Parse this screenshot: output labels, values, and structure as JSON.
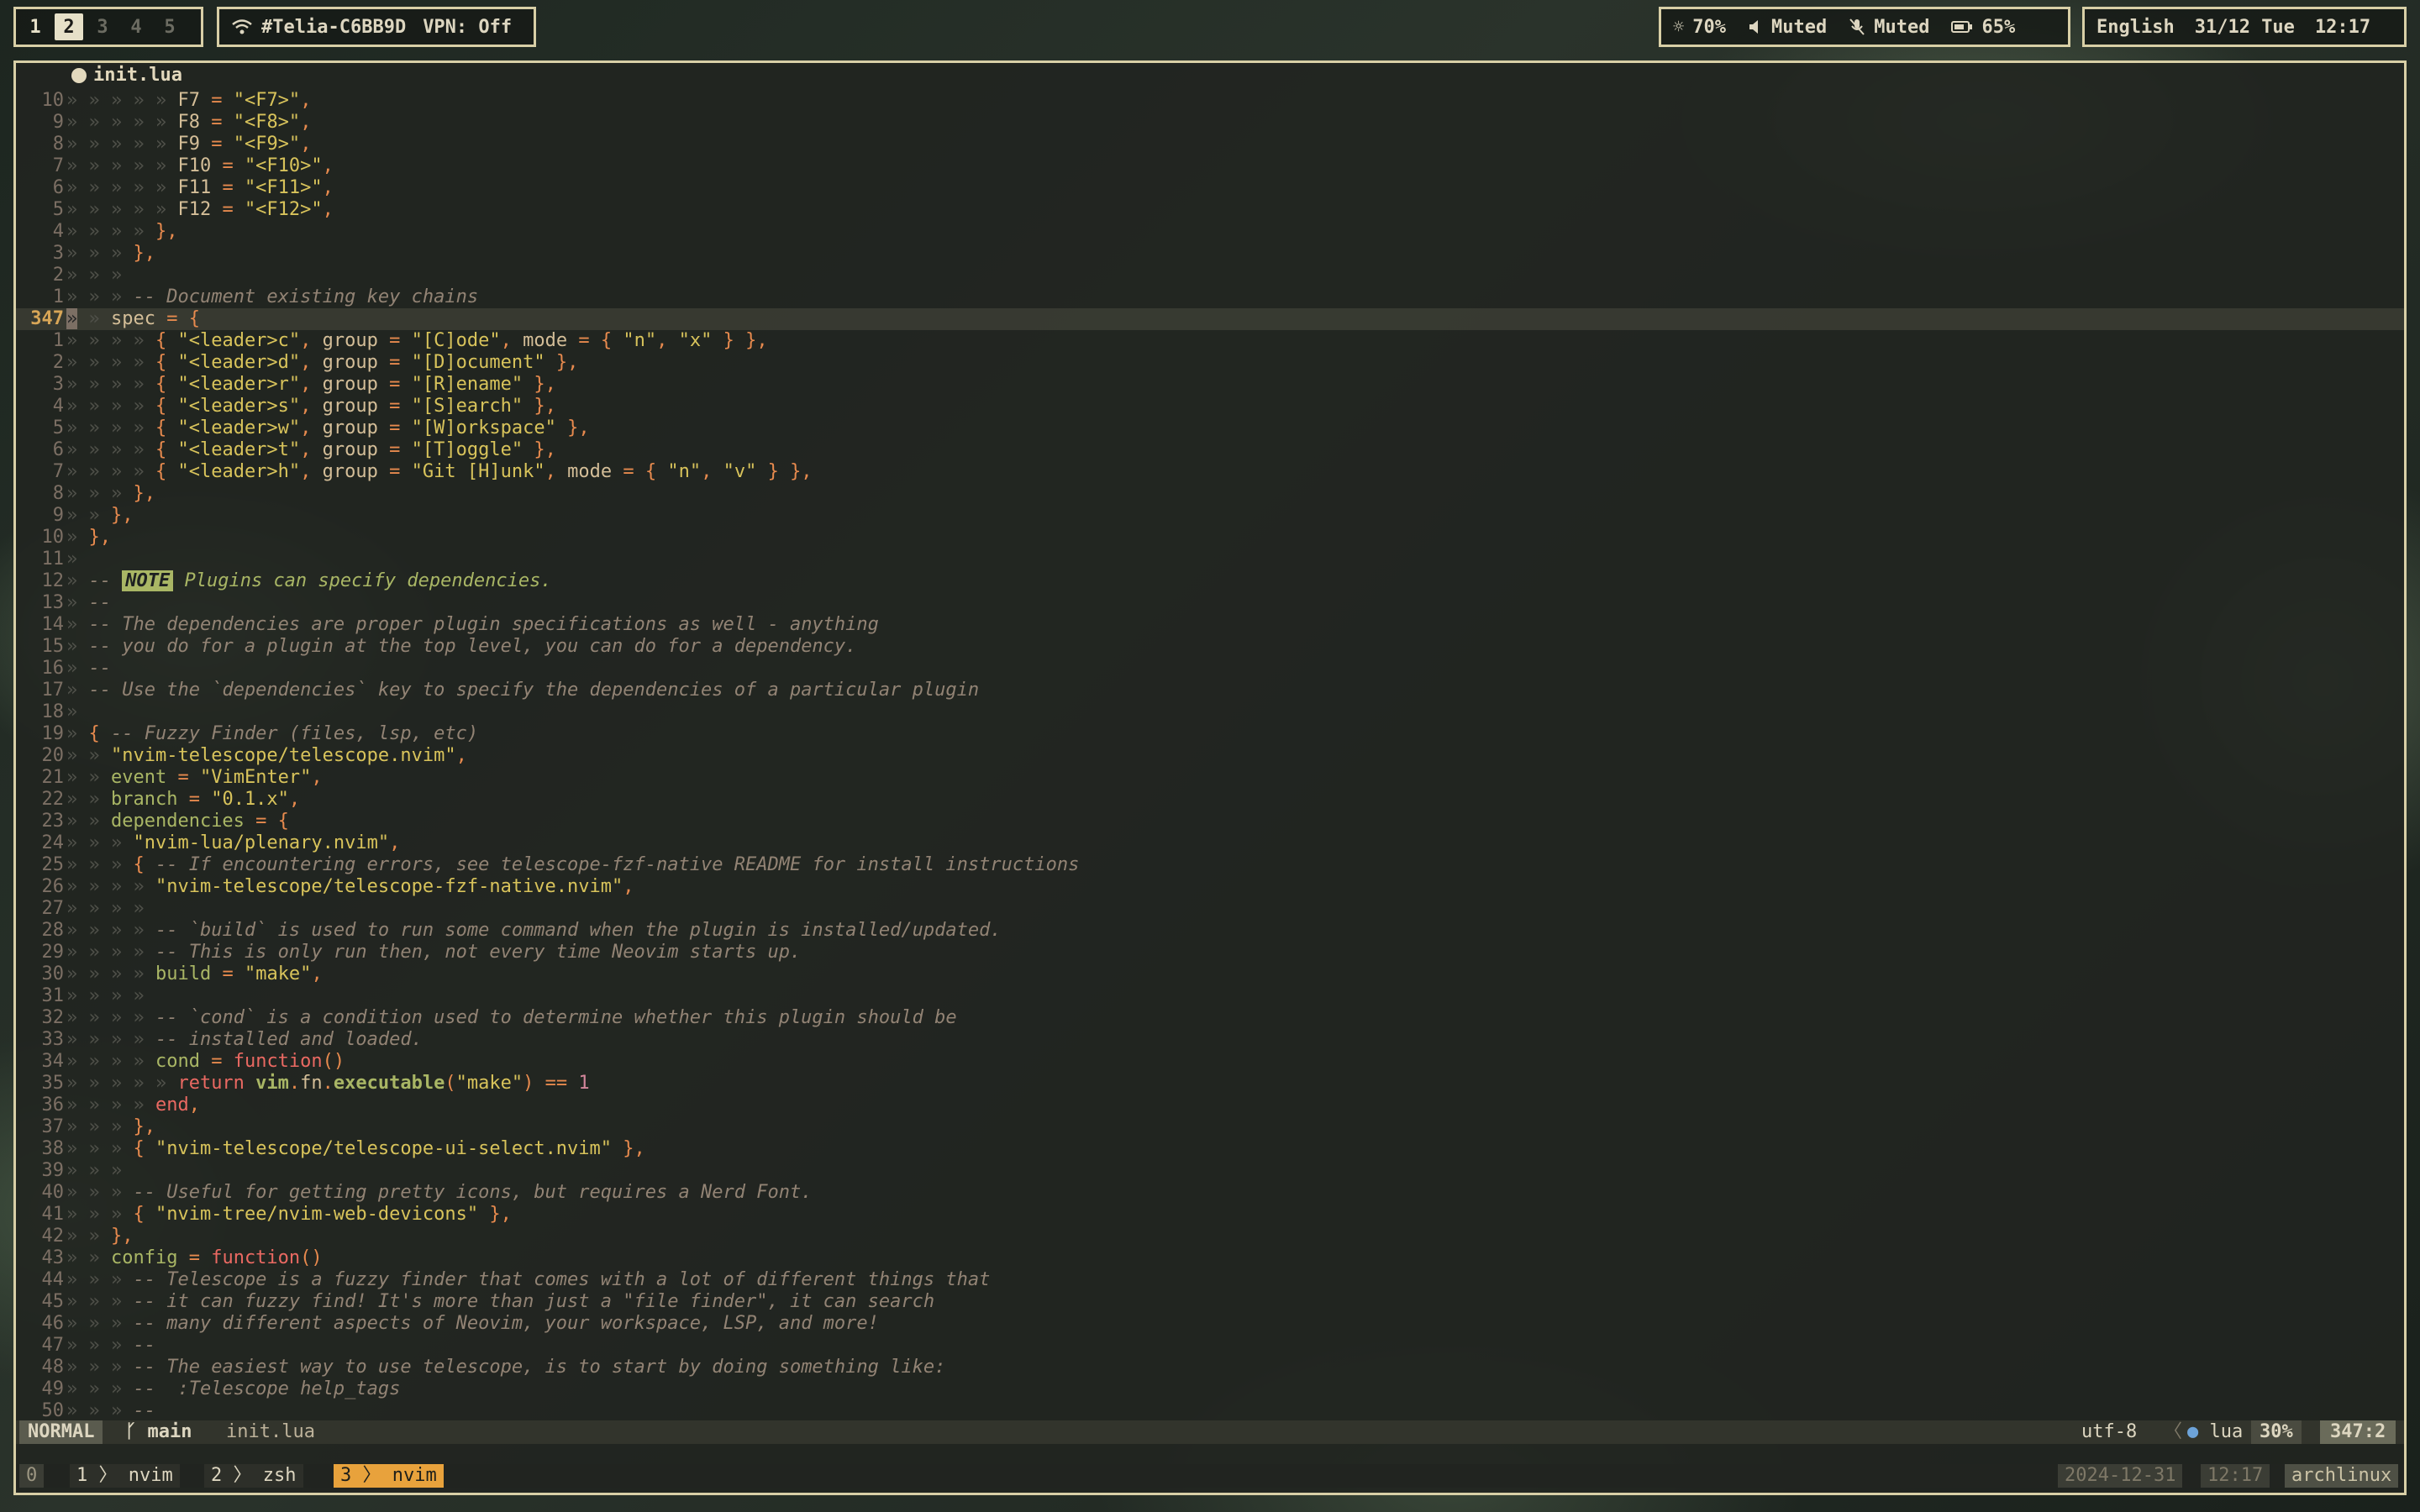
{
  "topbar": {
    "workspaces": [
      "1",
      "2",
      "3",
      "4",
      "5"
    ],
    "active_workspace": "2",
    "wifi_name": "#Telia-C6BB9D",
    "vpn": "VPN: Off",
    "brightness": "70%",
    "volume": "Muted",
    "mic": "Muted",
    "battery": "65%",
    "language": "English",
    "date": "31/12 Tue",
    "time": "12:17"
  },
  "editor": {
    "tab_title": "init.lua",
    "current_line_number": "347",
    "mode": "NORMAL",
    "branch": "main",
    "filename": "init.lua",
    "encoding": "utf-8",
    "filetype": "lua",
    "percent": "30%",
    "position": "347:2",
    "line_numbers": [
      "10",
      "9",
      "8",
      "7",
      "6",
      "5",
      "4",
      "3",
      "2",
      "1",
      "347",
      "1",
      "2",
      "3",
      "4",
      "5",
      "6",
      "7",
      "8",
      "9",
      "10",
      "11",
      "12",
      "13",
      "14",
      "15",
      "16",
      "17",
      "18",
      "19",
      "20",
      "21",
      "22",
      "23",
      "24",
      "25",
      "26",
      "27",
      "28",
      "29",
      "30",
      "31",
      "32",
      "33",
      "34",
      "35",
      "36",
      "37",
      "38",
      "39",
      "40",
      "41",
      "42",
      "43",
      "44",
      "45",
      "46",
      "47",
      "48",
      "49",
      "50"
    ]
  },
  "tmux": {
    "left": "0",
    "windows": [
      {
        "index": "1",
        "name": "nvim"
      },
      {
        "index": "2",
        "name": "zsh"
      },
      {
        "index": "3",
        "name": "nvim"
      }
    ],
    "date": "2024-12-31",
    "time": "12:17",
    "host": "archlinux"
  }
}
